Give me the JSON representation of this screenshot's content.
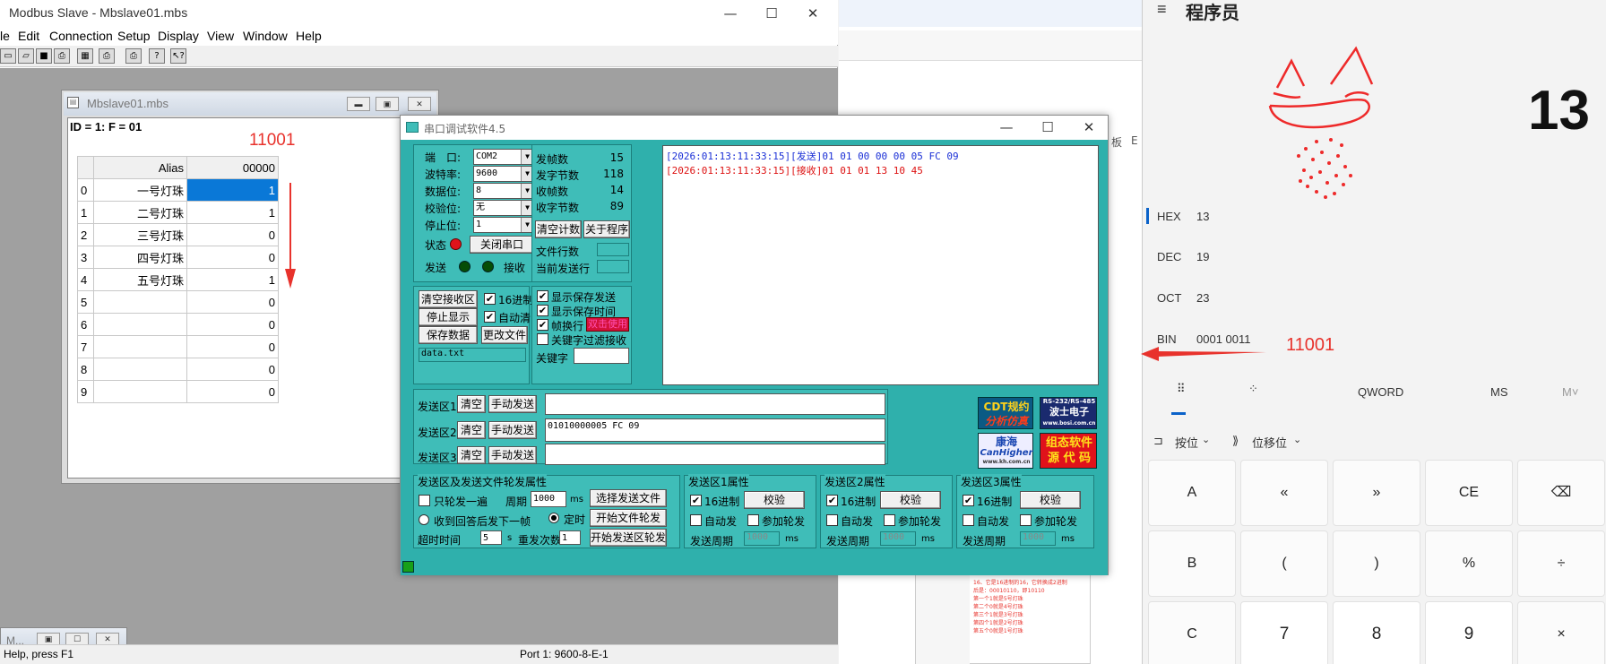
{
  "modbus": {
    "title": "Modbus Slave - Mbslave01.mbs",
    "menu": [
      "le",
      "Edit",
      "Connection",
      "Setup",
      "Display",
      "View",
      "Window",
      "Help"
    ],
    "toolbar_icons": [
      "new-icon",
      "open-icon",
      "save-icon",
      "print-icon",
      "sheet-icon",
      "printer2-icon",
      "printer3-icon",
      "help-icon",
      "context-help-icon"
    ],
    "child": {
      "title": "Mbslave01.mbs",
      "id_line": "ID = 1: F = 01",
      "annotation": "11001",
      "header": {
        "alias": "Alias",
        "value": "00000"
      },
      "rows": [
        {
          "n": "0",
          "alias": "一号灯珠",
          "value": "1"
        },
        {
          "n": "1",
          "alias": "二号灯珠",
          "value": "1"
        },
        {
          "n": "2",
          "alias": "三号灯珠",
          "value": "0"
        },
        {
          "n": "3",
          "alias": "四号灯珠",
          "value": "0"
        },
        {
          "n": "4",
          "alias": "五号灯珠",
          "value": "1"
        },
        {
          "n": "5",
          "alias": "",
          "value": "0"
        },
        {
          "n": "6",
          "alias": "",
          "value": "0"
        },
        {
          "n": "7",
          "alias": "",
          "value": "0"
        },
        {
          "n": "8",
          "alias": "",
          "value": "0"
        },
        {
          "n": "9",
          "alias": "",
          "value": "0"
        }
      ]
    },
    "minimized_title": "M...",
    "status_left": "Help, press F1",
    "status_right": "Port 1: 9600-8-E-1"
  },
  "serial": {
    "title": "串口调试软件4.5",
    "port": {
      "label": "端　口:",
      "value": "COM2"
    },
    "baud": {
      "label": "波特率:",
      "value": "9600"
    },
    "databits": {
      "label": "数据位:",
      "value": "8"
    },
    "parity": {
      "label": "校验位:",
      "value": "无"
    },
    "stopbits": {
      "label": "停止位:",
      "value": "1"
    },
    "status_label": "状态",
    "close_port": "关闭串口",
    "send_label": "发送",
    "recv_label": "接收",
    "stats": {
      "tx_frames_label": "发帧数",
      "tx_frames": "15",
      "tx_bytes_label": "发字节数",
      "tx_bytes": "118",
      "rx_frames_label": "收帧数",
      "rx_frames": "14",
      "rx_bytes_label": "收字节数",
      "rx_bytes": "89"
    },
    "clear_count": "清空计数",
    "about": "关于程序",
    "file_lines": "文件行数",
    "current_line": "当前发送行",
    "recv_lines": [
      {
        "ts": "[2026:01:13:11:33:15]",
        "tag": "[发送]",
        "data": "01 01 00 00 00 05 FC 09"
      },
      {
        "ts": "[2026:01:13:11:33:15]",
        "tag": "[接收]",
        "data": "01 01 01 13 10 45"
      }
    ],
    "clear_recv": "清空接收区",
    "hex16": "16进制",
    "stop_display": "停止显示",
    "auto_clear": "自动清",
    "save_data": "保存数据",
    "change_file": "更改文件",
    "filename": "data.txt",
    "show_save_send": "显示保存发送",
    "show_save_time": "显示保存时间",
    "frame_newline": "帧换行",
    "newline_badge": "双击使用",
    "keyword_filter": "关键字过滤接收",
    "keyword_label": "关键字",
    "send_areas": [
      {
        "label": "发送区1",
        "clear": "清空",
        "manual": "手动发送",
        "content": ""
      },
      {
        "label": "发送区2",
        "clear": "清空",
        "manual": "手动发送",
        "content": "01010000005 FC 09"
      },
      {
        "label": "发送区3",
        "clear": "清空",
        "manual": "手动发送",
        "content": ""
      }
    ],
    "ads": [
      {
        "line1": "CDT规约",
        "line2": "分析仿真"
      },
      {
        "line1": "RS-232/RS-485",
        "line2": "波士电子",
        "line3": "www.bosi.com.cn"
      },
      {
        "line1": "康海",
        "line2": "CanHigher",
        "line3": "www.kh.com.cn"
      },
      {
        "line1": "组态软件",
        "line2": "源 代 码"
      }
    ],
    "file_props": {
      "legend": "发送区及发送文件轮发属性",
      "once": "只轮发一遍",
      "period_label": "周期",
      "period": "1000",
      "ms": "ms",
      "select_file": "选择发送文件",
      "reply_next": "收到回答后发下一帧",
      "timed": "定时",
      "start_file": "开始文件轮发",
      "timeout_label": "超时时间",
      "timeout": "5",
      "s": "s",
      "retry_label": "重发次数",
      "retry": "1",
      "start_area": "开始发送区轮发"
    },
    "area_props": [
      {
        "legend": "发送区1属性",
        "hex": "16进制",
        "verify": "校验",
        "auto": "自动发",
        "poll": "参加轮发",
        "period_label": "发送周期",
        "period": "1000",
        "ms": "ms"
      },
      {
        "legend": "发送区2属性",
        "hex": "16进制",
        "verify": "校验",
        "auto": "自动发",
        "poll": "参加轮发",
        "period_label": "发送周期",
        "period": "1000",
        "ms": "ms"
      },
      {
        "legend": "发送区3属性",
        "hex": "16进制",
        "verify": "校验",
        "auto": "自动发",
        "poll": "参加轮发",
        "period_label": "发送周期",
        "period": "1000",
        "ms": "ms"
      }
    ]
  },
  "calculator": {
    "title": "程序员",
    "display": "13",
    "hex": {
      "label": "HEX",
      "value": "13"
    },
    "dec": {
      "label": "DEC",
      "value": "19"
    },
    "oct": {
      "label": "OCT",
      "value": "23"
    },
    "bin": {
      "label": "BIN",
      "value": "0001 0011"
    },
    "annotation": "11001",
    "word_size": "QWORD",
    "ms": "MS",
    "mplus": "M˅",
    "bitwise": "按位",
    "bitshift": "位移位",
    "keys": [
      [
        "A",
        "«",
        "»",
        "CE",
        "⌫"
      ],
      [
        "B",
        "(",
        ")",
        "%",
        "÷"
      ],
      [
        "C",
        "7",
        "8",
        "9",
        "×"
      ]
    ]
  },
  "background": {
    "ribbon_labels": [
      "板",
      "E"
    ],
    "notes": [
      "16、它是16进制的16，它转换成2进制",
      "后是：00010110，即10110",
      "第一个1就是5号灯珠",
      "第二个0就是4号灯珠",
      "第三个1就是3号灯珠",
      "第四个1就是2号灯珠",
      "第五个0就是1号灯珠"
    ]
  },
  "colors": {
    "teal": "#2fb0ac",
    "annotation_red": "#e8322c",
    "selection_blue": "#0a78d7"
  }
}
